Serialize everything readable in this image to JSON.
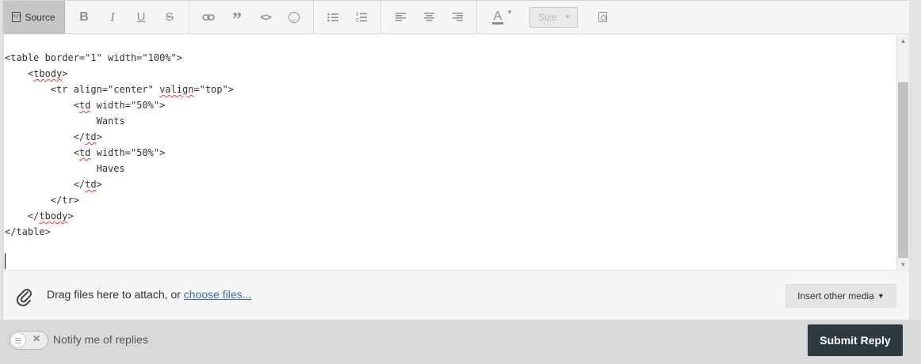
{
  "toolbar": {
    "source_label": "Source",
    "bold": "B",
    "italic": "I",
    "underline": "U",
    "strike": "S",
    "quote": "”",
    "code": "<>",
    "color": "A",
    "size_label": "Size",
    "icons": [
      "source-icon",
      "bold-icon",
      "italic-icon",
      "underline-icon",
      "strikethrough-icon",
      "link-icon",
      "quote-icon",
      "code-icon",
      "smiley-icon",
      "bulleted-list-icon",
      "numbered-list-icon",
      "align-left-icon",
      "align-center-icon",
      "align-right-icon",
      "text-color-icon",
      "preview-icon"
    ]
  },
  "editor": {
    "lines": [
      {
        "pre": "<table border=\"1\" width=\"100%\">",
        "sq": "",
        "post": ""
      },
      {
        "pre": "    <",
        "sq": "tbody",
        "post": ">"
      },
      {
        "pre": "        <tr align=\"center\" ",
        "sq": "valign",
        "post": "=\"top\">"
      },
      {
        "pre": "            <",
        "sq": "td",
        "post": " width=\"50%\">"
      },
      {
        "pre": "                Wants",
        "sq": "",
        "post": ""
      },
      {
        "pre": "            </",
        "sq": "td",
        "post": ">"
      },
      {
        "pre": "            <",
        "sq": "td",
        "post": " width=\"50%\">"
      },
      {
        "pre": "                Haves",
        "sq": "",
        "post": ""
      },
      {
        "pre": "            </",
        "sq": "td",
        "post": ">"
      },
      {
        "pre": "        </tr>",
        "sq": "",
        "post": ""
      },
      {
        "pre": "    </",
        "sq": "tbody",
        "post": ">"
      },
      {
        "pre": "</table>",
        "sq": "",
        "post": ""
      }
    ]
  },
  "attach": {
    "text": "Drag files here to attach, or ",
    "link": "choose files...",
    "insert_media": "Insert other media"
  },
  "footer": {
    "notify_label": "Notify me of replies",
    "submit_label": "Submit Reply"
  },
  "colors": {
    "submit_bg": "#2e3a42",
    "link": "#3a6ea5",
    "spell_error": "#e53935"
  }
}
